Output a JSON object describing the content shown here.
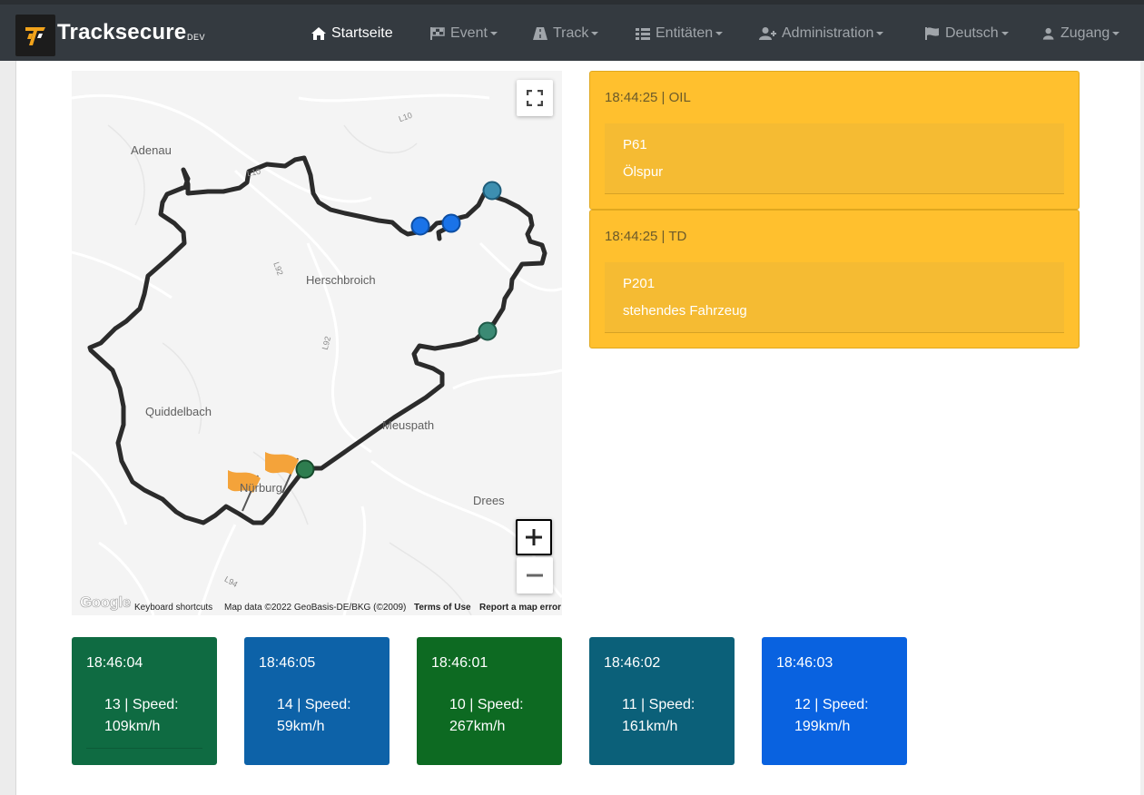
{
  "app": {
    "brand": "Tracksecure",
    "env_badge": "DEV"
  },
  "nav": {
    "items": [
      {
        "label": "Startseite",
        "icon": "home-icon",
        "active": true
      },
      {
        "label": "Event",
        "icon": "checkered-flag-icon",
        "dropdown": true
      },
      {
        "label": "Track",
        "icon": "road-icon",
        "dropdown": true
      },
      {
        "label": "Entitäten",
        "icon": "list-icon",
        "dropdown": true
      },
      {
        "label": "Administration",
        "icon": "user-plus-icon",
        "dropdown": true
      },
      {
        "label": "Deutsch",
        "icon": "flag-icon",
        "dropdown": true
      },
      {
        "label": "Zugang",
        "icon": "user-icon",
        "dropdown": true
      }
    ]
  },
  "map": {
    "places": [
      "Adenau",
      "Herschbroich",
      "Quiddelbach",
      "Meuspath",
      "Nürburg",
      "Drees"
    ],
    "roads": [
      "L10",
      "L10",
      "L92",
      "L92",
      "L94"
    ],
    "zoom_in": "+",
    "zoom_out": "−",
    "attribution": {
      "shortcuts": "Keyboard shortcuts",
      "data": "Map data ©2022 GeoBasis-DE/BKG (©2009)",
      "terms": "Terms of Use",
      "report": "Report a map error"
    },
    "logo": "Google"
  },
  "alerts": [
    {
      "time_type": "18:44:25 | OIL",
      "code": "P61",
      "description": "Ölspur",
      "color": "#ffc02e"
    },
    {
      "time_type": "18:44:25 | TD",
      "code": "P201",
      "description": "stehendes Fahrzeug",
      "color": "#ffc02e"
    }
  ],
  "vehicles": [
    {
      "time": "18:46:04",
      "id_speed": "13 | Speed:",
      "speed": "109km/h",
      "color": "#0f6b42"
    },
    {
      "time": "18:46:05",
      "id_speed": "14 | Speed:",
      "speed": "59km/h",
      "color": "#0d62a8"
    },
    {
      "time": "18:46:01",
      "id_speed": "10 | Speed:",
      "speed": "267km/h",
      "color": "#0d6a22"
    },
    {
      "time": "18:46:02",
      "id_speed": "11 | Speed:",
      "speed": "161km/h",
      "color": "#0b6079"
    },
    {
      "time": "18:46:03",
      "id_speed": "12 | Speed:",
      "speed": "199km/h",
      "color": "#0962e0"
    }
  ]
}
